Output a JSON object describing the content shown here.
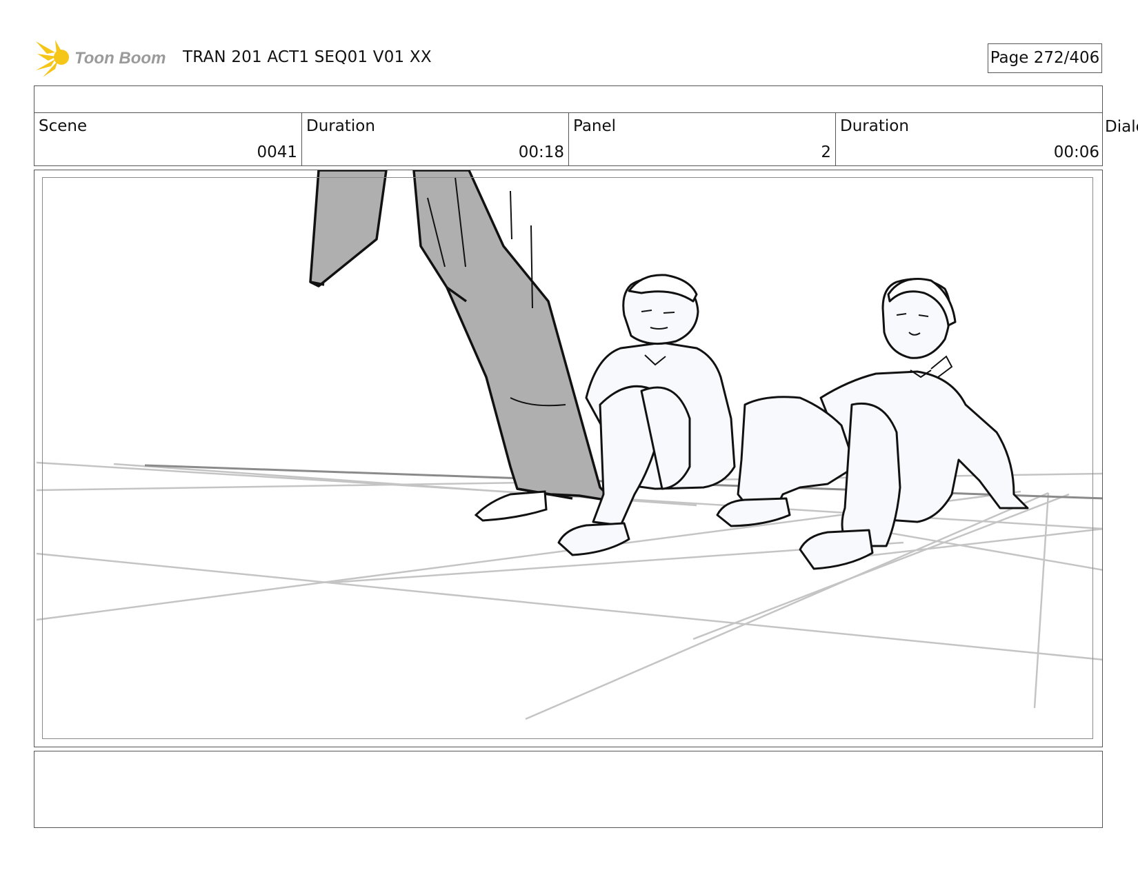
{
  "header": {
    "logo_text": "Toon Boom",
    "title": "TRAN 201 ACT1 SEQ01 V01 XX",
    "page": "Page 272/406"
  },
  "info": {
    "scene_label": "Scene",
    "scene_value": "0041",
    "scene_duration_label": "Duration",
    "scene_duration_value": "00:18",
    "panel_label": "Panel",
    "panel_value": "2",
    "panel_duration_label": "Duration",
    "panel_duration_value": "00:06",
    "dialog_label": "Dialo"
  },
  "colors": {
    "logo_yellow": "#F5C518",
    "logo_gray": "#9A9A9A",
    "pants_gray": "#AFAFAF",
    "floor_lines": "#C4C4C4",
    "shirt_fill": "#F7F9FC"
  }
}
